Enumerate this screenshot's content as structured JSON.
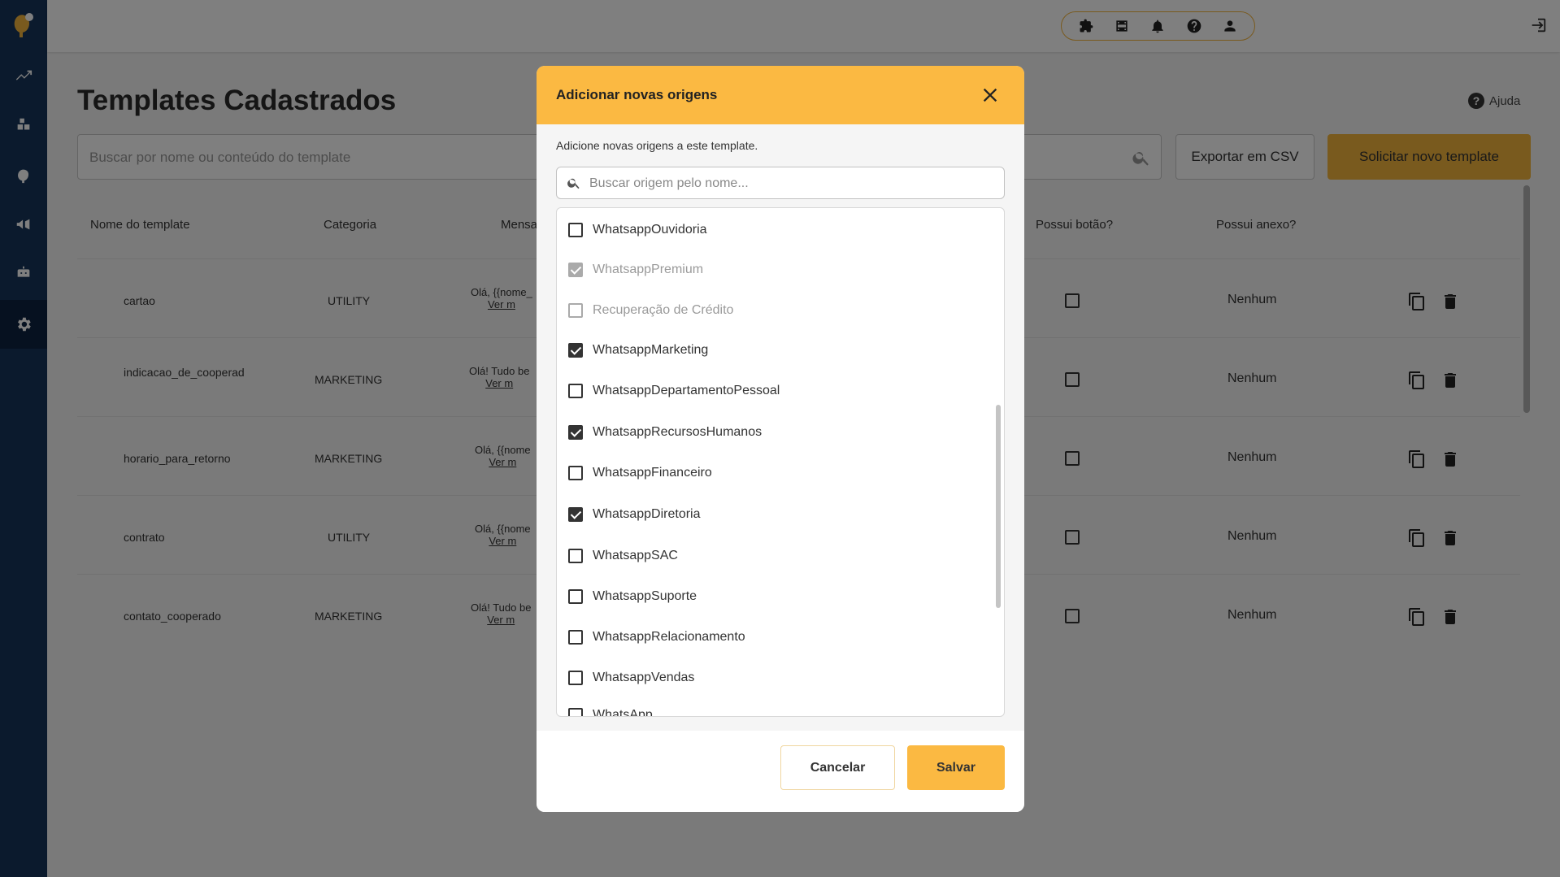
{
  "header": {
    "title": "Templates Cadastrados",
    "help_label": "Ajuda"
  },
  "search": {
    "placeholder": "Buscar por nome ou conteúdo do template"
  },
  "buttons": {
    "export_csv": "Exportar em CSV",
    "new_template": "Solicitar novo template"
  },
  "table": {
    "columns": [
      "Nome do template",
      "Categoria",
      "Mensa",
      "Possui botão?",
      "Possui anexo?"
    ],
    "rows": [
      {
        "name": "cartao",
        "category": "UTILITY",
        "message": "Olá, {{nome_",
        "more": "Ver m",
        "attachment": "Nenhum"
      },
      {
        "name": "indicacao_de_cooperad",
        "category": "MARKETING",
        "message": "Olá! Tudo be",
        "more": "Ver m",
        "attachment": "Nenhum"
      },
      {
        "name": "horario_para_retorno",
        "category": "MARKETING",
        "message": "Olá, {{nome",
        "more": "Ver m",
        "attachment": "Nenhum"
      },
      {
        "name": "contrato",
        "category": "UTILITY",
        "message": "Olá, {{nome",
        "more": "Ver m",
        "attachment": "Nenhum"
      },
      {
        "name": "contato_cooperado",
        "category": "MARKETING",
        "message": "Olá! Tudo be",
        "more": "Ver m",
        "attachment": "Nenhum"
      }
    ]
  },
  "modal": {
    "title": "Adicionar novas origens",
    "subtitle": "Adicione novas origens a este template.",
    "search_placeholder": "Buscar origem pelo nome...",
    "items": [
      {
        "label": "WhatsappOuvidoria",
        "checked": false,
        "disabled": false
      },
      {
        "label": "WhatsappPremium",
        "checked": true,
        "disabled": true
      },
      {
        "label": "Recuperação de Crédito",
        "checked": false,
        "disabled": true
      },
      {
        "label": "WhatsappMarketing",
        "checked": true,
        "disabled": false
      },
      {
        "label": "WhatsappDepartamentoPessoal",
        "checked": false,
        "disabled": false
      },
      {
        "label": "WhatsappRecursosHumanos",
        "checked": true,
        "disabled": false
      },
      {
        "label": "WhatsappFinanceiro",
        "checked": false,
        "disabled": false
      },
      {
        "label": "WhatsappDiretoria",
        "checked": true,
        "disabled": false
      },
      {
        "label": "WhatsappSAC",
        "checked": false,
        "disabled": false
      },
      {
        "label": "WhatsappSuporte",
        "checked": false,
        "disabled": false
      },
      {
        "label": "WhatsappRelacionamento",
        "checked": false,
        "disabled": false
      },
      {
        "label": "WhatsappVendas",
        "checked": false,
        "disabled": false
      },
      {
        "label": "WhatsApp",
        "checked": false,
        "disabled": false
      }
    ],
    "cancel_label": "Cancelar",
    "save_label": "Salvar"
  },
  "colors": {
    "sidebar": "#16345a",
    "accent": "#fbb942"
  }
}
